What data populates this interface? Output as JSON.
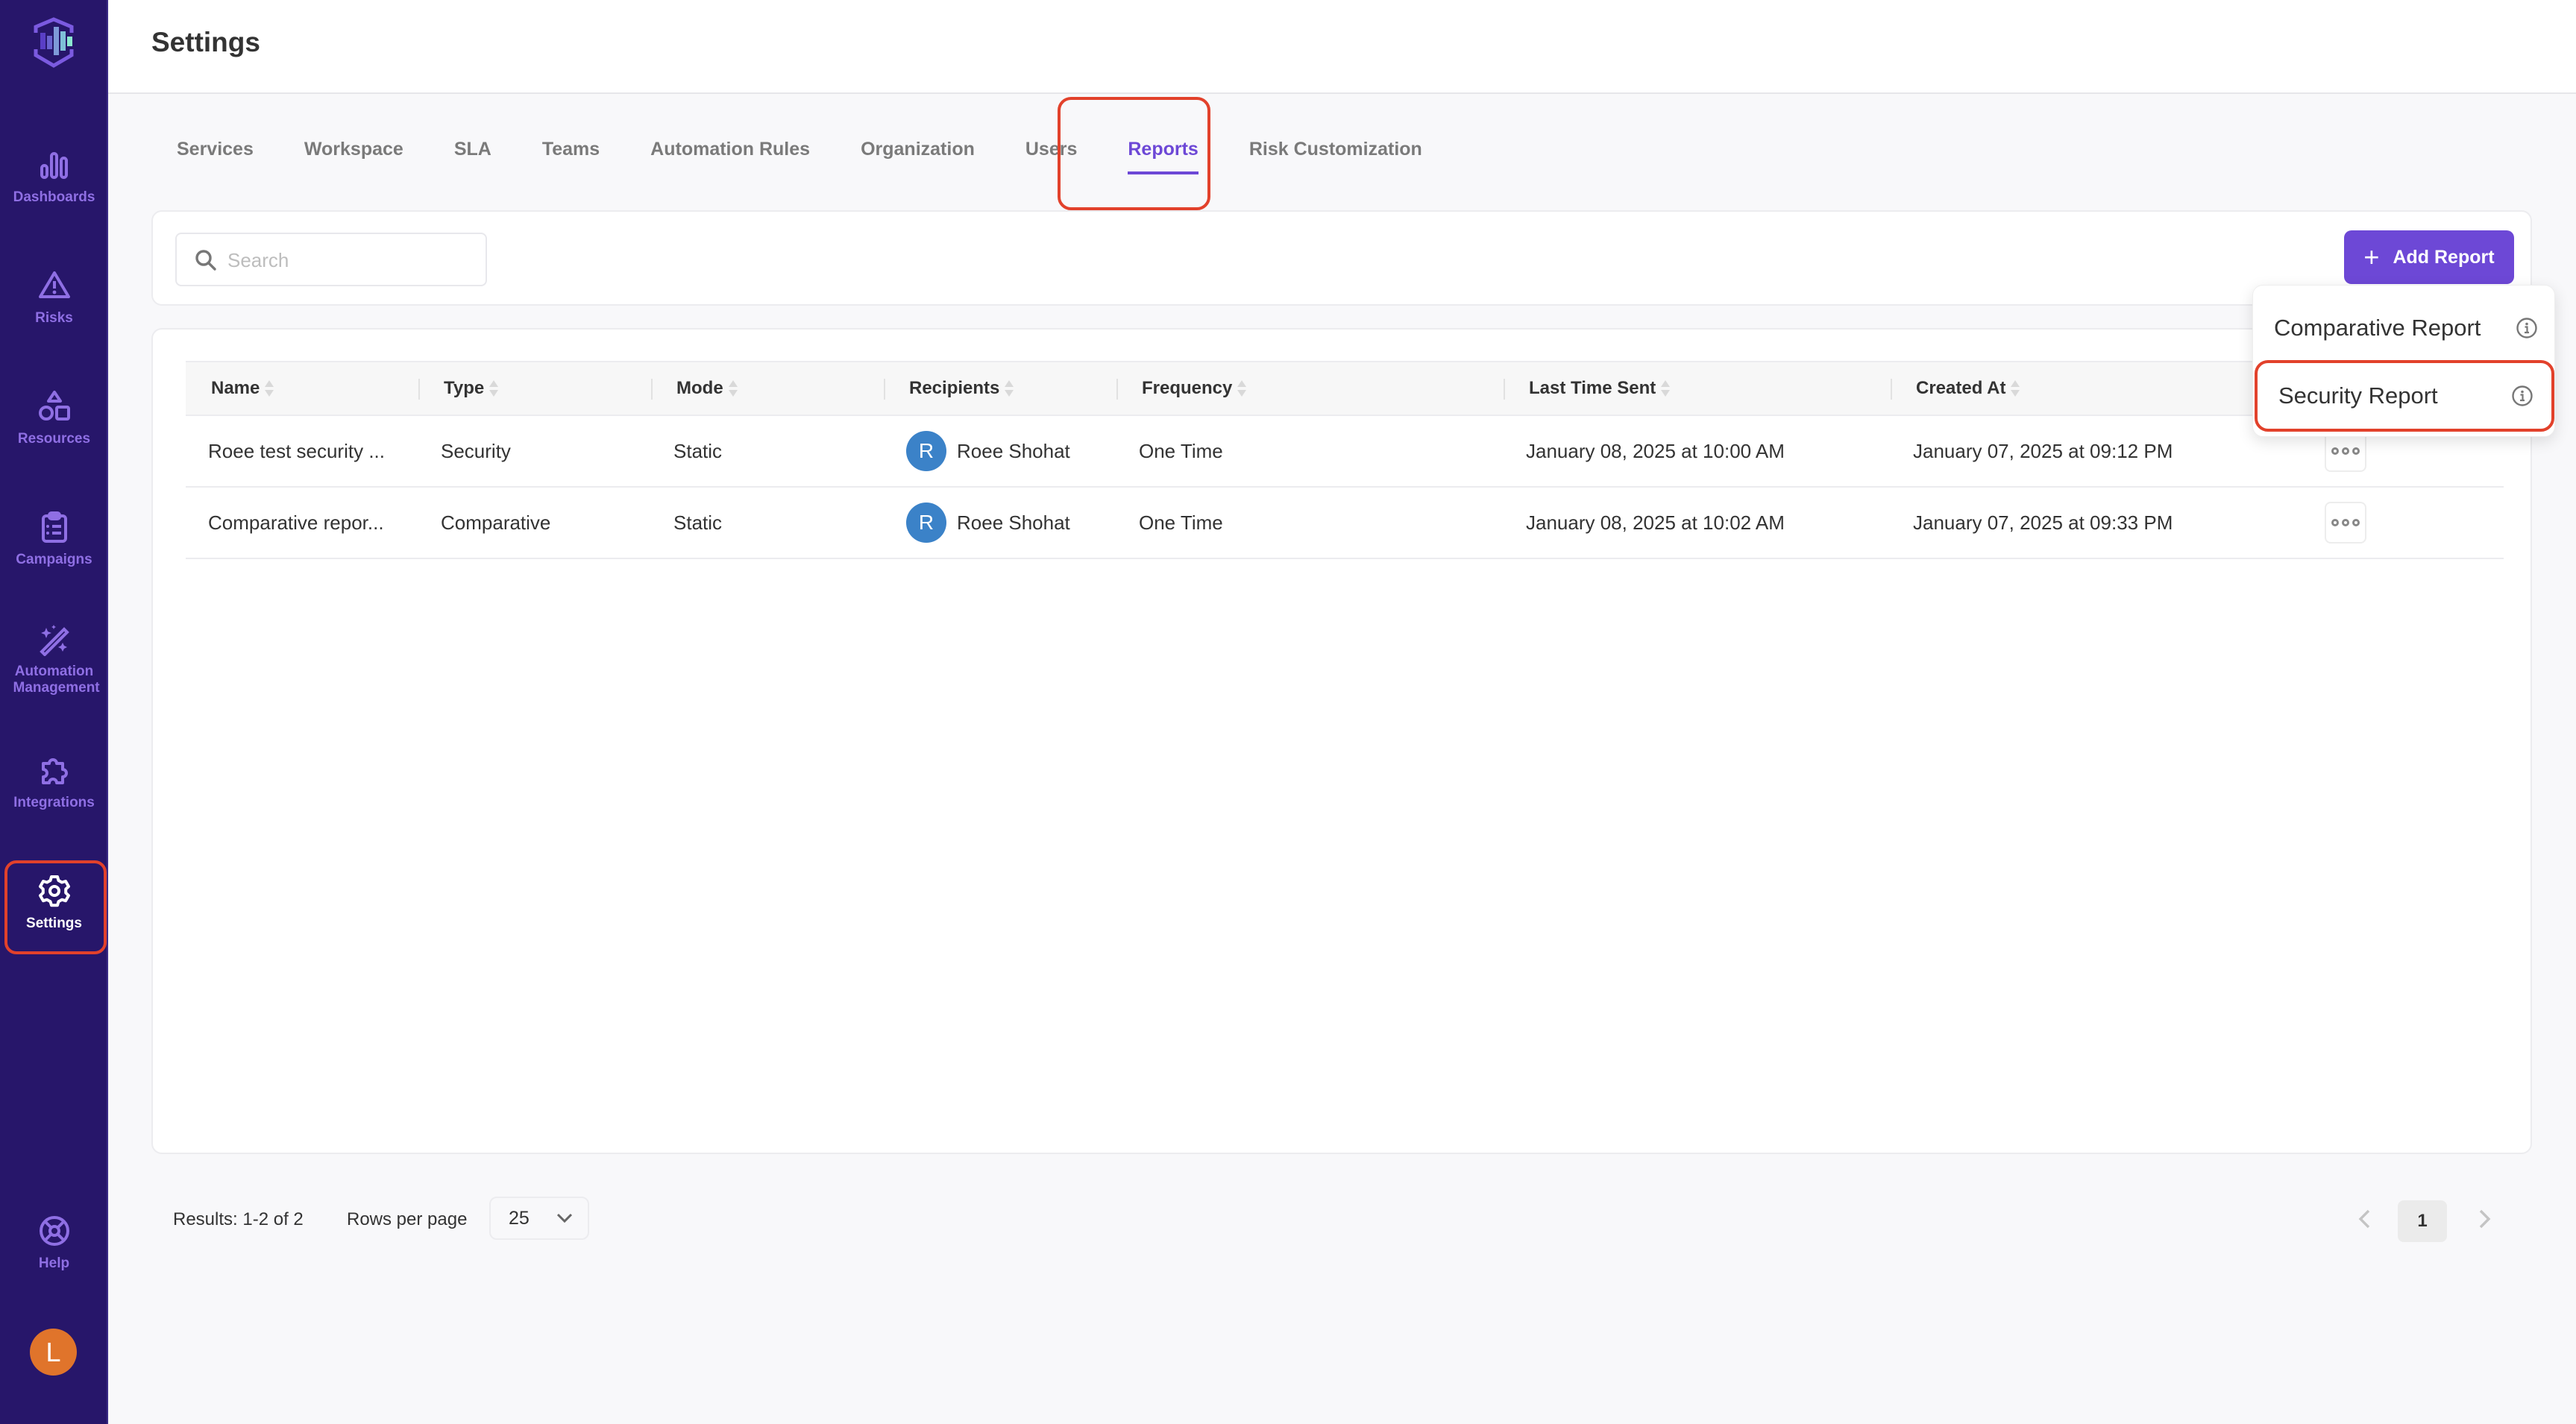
{
  "sidebar": {
    "logo": "shield-bars-logo",
    "items": [
      {
        "label": "Dashboards",
        "icon": "bar-chart-icon"
      },
      {
        "label": "Risks",
        "icon": "warning-triangle-icon"
      },
      {
        "label": "Resources",
        "icon": "shapes-icon"
      },
      {
        "label": "Campaigns",
        "icon": "clipboard-list-icon"
      },
      {
        "label": "Automation Management",
        "icon": "magic-wand-icon"
      },
      {
        "label": "Integrations",
        "icon": "puzzle-icon"
      },
      {
        "label": "Settings",
        "icon": "gear-icon",
        "active": true
      },
      {
        "label": "Help",
        "icon": "lifebuoy-icon"
      }
    ],
    "user_initial": "L"
  },
  "header": {
    "title": "Settings"
  },
  "tabs": [
    {
      "label": "Services"
    },
    {
      "label": "Workspace"
    },
    {
      "label": "SLA"
    },
    {
      "label": "Teams"
    },
    {
      "label": "Automation Rules"
    },
    {
      "label": "Organization"
    },
    {
      "label": "Users"
    },
    {
      "label": "Reports",
      "active": true
    },
    {
      "label": "Risk Customization"
    }
  ],
  "toolbar": {
    "search_placeholder": "Search",
    "search_value": "",
    "add_button_label": "Add Report"
  },
  "add_menu": {
    "items": [
      {
        "label": "Comparative Report",
        "icon": "info-icon"
      },
      {
        "label": "Security Report",
        "icon": "info-icon",
        "highlighted": true
      }
    ]
  },
  "table": {
    "columns": [
      "Name",
      "Type",
      "Mode",
      "Recipients",
      "Frequency",
      "Last Time Sent",
      "Created At"
    ],
    "rows": [
      {
        "name": "Roee test security ...",
        "type": "Security",
        "mode": "Static",
        "recipient_initial": "R",
        "recipient": "Roee Shohat",
        "frequency": "One Time",
        "last_sent": "January 08, 2025 at 10:00 AM",
        "created_at": "January 07, 2025 at 09:12 PM"
      },
      {
        "name": "Comparative repor...",
        "type": "Comparative",
        "mode": "Static",
        "recipient_initial": "R",
        "recipient": "Roee Shohat",
        "frequency": "One Time",
        "last_sent": "January 08, 2025 at 10:02 AM",
        "created_at": "January 07, 2025 at 09:33 PM"
      }
    ]
  },
  "footer": {
    "results": "Results: 1-2 of 2",
    "rows_per_page_label": "Rows per page",
    "rows_per_page_value": "25",
    "current_page": "1"
  },
  "colors": {
    "sidebar_bg": "#27166a",
    "accent": "#6d48d6",
    "highlight_outline": "#e2412b",
    "user_avatar": "#e0742b",
    "recipient_avatar": "#3b82c8"
  }
}
